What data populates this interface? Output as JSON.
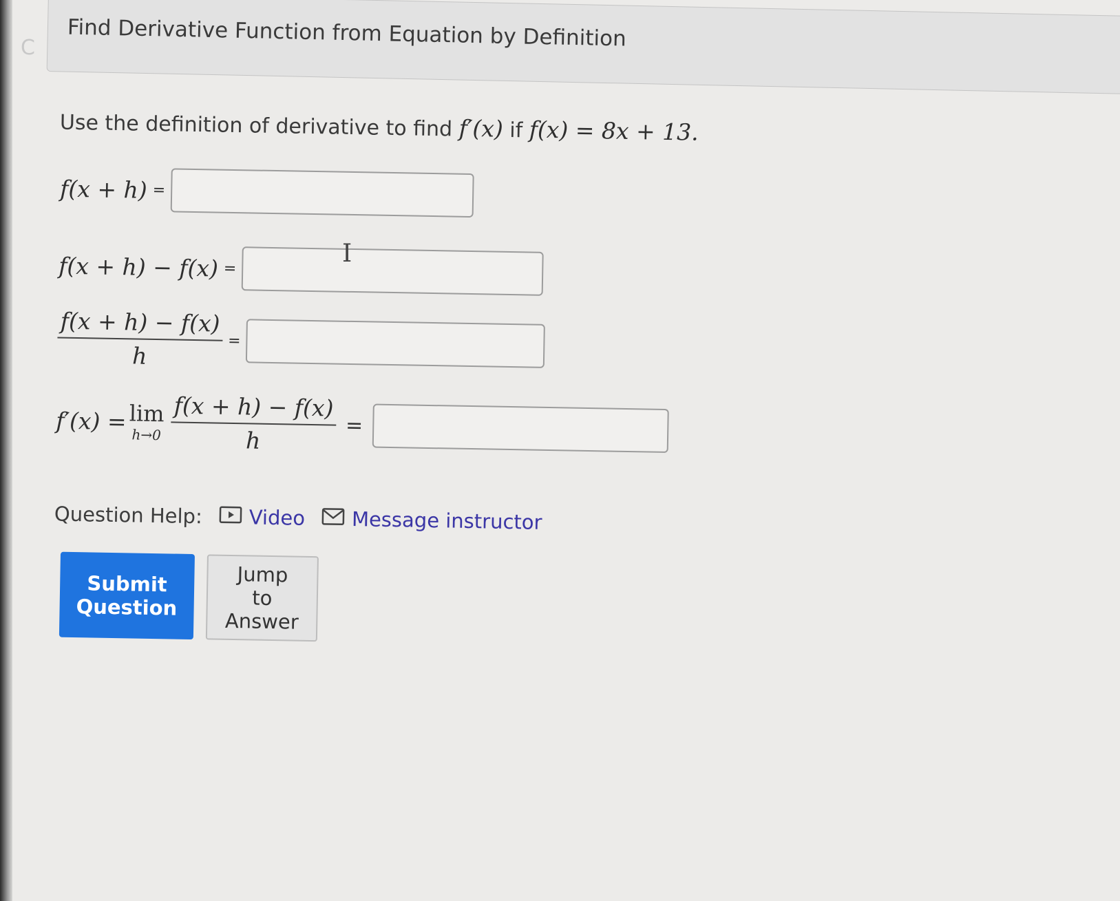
{
  "header": {
    "title": "Find Derivative Function from Equation by Definition"
  },
  "question": {
    "prompt_text": "Use the definition of derivative to find",
    "prompt_target": "f′(x)",
    "prompt_if": "if",
    "prompt_function": "f(x) = 8x + 13."
  },
  "rows": [
    {
      "label": "f(x + h)",
      "equals": "=",
      "value": "",
      "placeholder": ""
    },
    {
      "label": "f(x + h) − f(x)",
      "equals": "=",
      "value": "",
      "placeholder": ""
    },
    {
      "label_numerator": "f(x + h) − f(x)",
      "label_denominator": "h",
      "equals": "=",
      "value": "",
      "placeholder": ""
    },
    {
      "label_prefix": "f′(x) =",
      "lim_word": "lim",
      "lim_sub": "h→0",
      "label_numerator": "f(x + h) − f(x)",
      "label_denominator": "h",
      "equals": "=",
      "value": "",
      "placeholder": ""
    }
  ],
  "help": {
    "label": "Question Help:",
    "video_label": "Video",
    "video_icon": "play-icon",
    "message_label": "Message instructor",
    "message_icon": "mail-icon",
    "link_color": "#3b36a6"
  },
  "buttons": {
    "submit_label": "Submit Question",
    "submit_color": "#1f74df",
    "jump_label": "Jump to Answer"
  }
}
